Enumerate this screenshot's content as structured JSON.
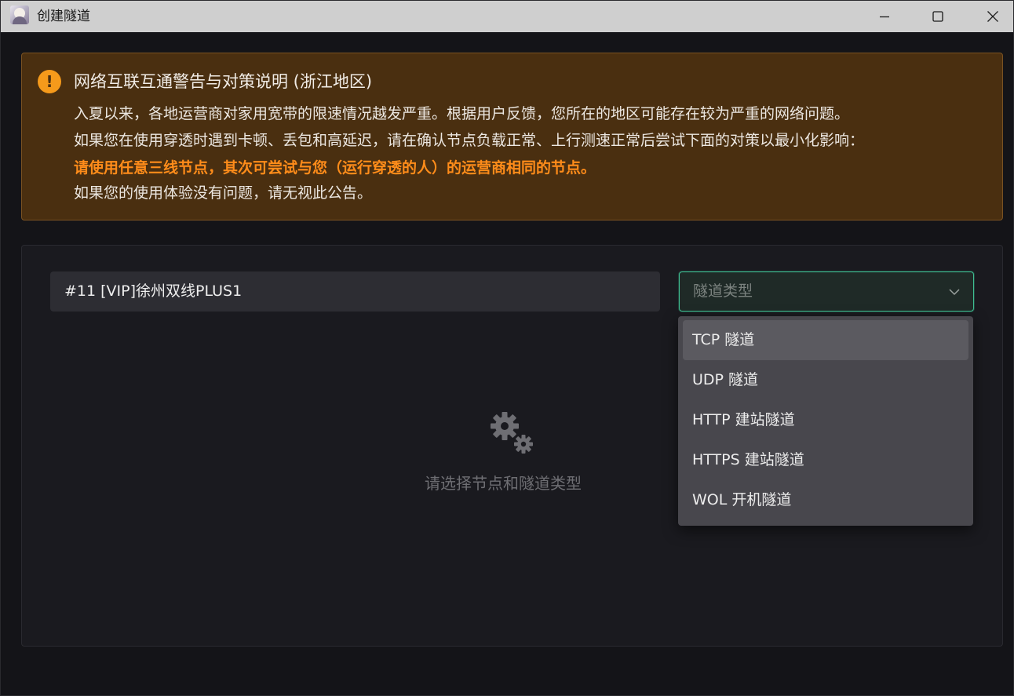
{
  "window": {
    "title": "创建隧道"
  },
  "banner": {
    "title": "网络互联互通警告与对策说明 (浙江地区)",
    "lines": [
      "入夏以来，各地运营商对家用宽带的限速情况越发严重。根据用户反馈，您所在的地区可能存在较为严重的网络问题。",
      "如果您在使用穿透时遇到卡顿、丢包和高延迟，请在确认节点负载正常、上行测速正常后尝试下面的对策以最小化影响：",
      "请使用任意三线节点，其次可尝试与您（运行穿透的人）的运营商相同的节点。",
      "如果您的使用体验没有问题，请无视此公告。"
    ],
    "icon": "warning-icon",
    "colors": {
      "background": "#4a2f10",
      "accent": "#f59a1b",
      "highlight_text": "#ff8c1a"
    }
  },
  "form": {
    "node_value": "#11 [VIP]徐州双线PLUS1",
    "tunnel_type_placeholder": "隧道类型",
    "tunnel_type_options": [
      "TCP 隧道",
      "UDP 隧道",
      "HTTP 建站隧道",
      "HTTPS 建站隧道",
      "WOL 开机隧道"
    ],
    "highlighted_option": "TCP 隧道",
    "accent_color": "#3fbf93"
  },
  "empty_state": {
    "icon": "gears-icon",
    "text": "请选择节点和隧道类型"
  }
}
